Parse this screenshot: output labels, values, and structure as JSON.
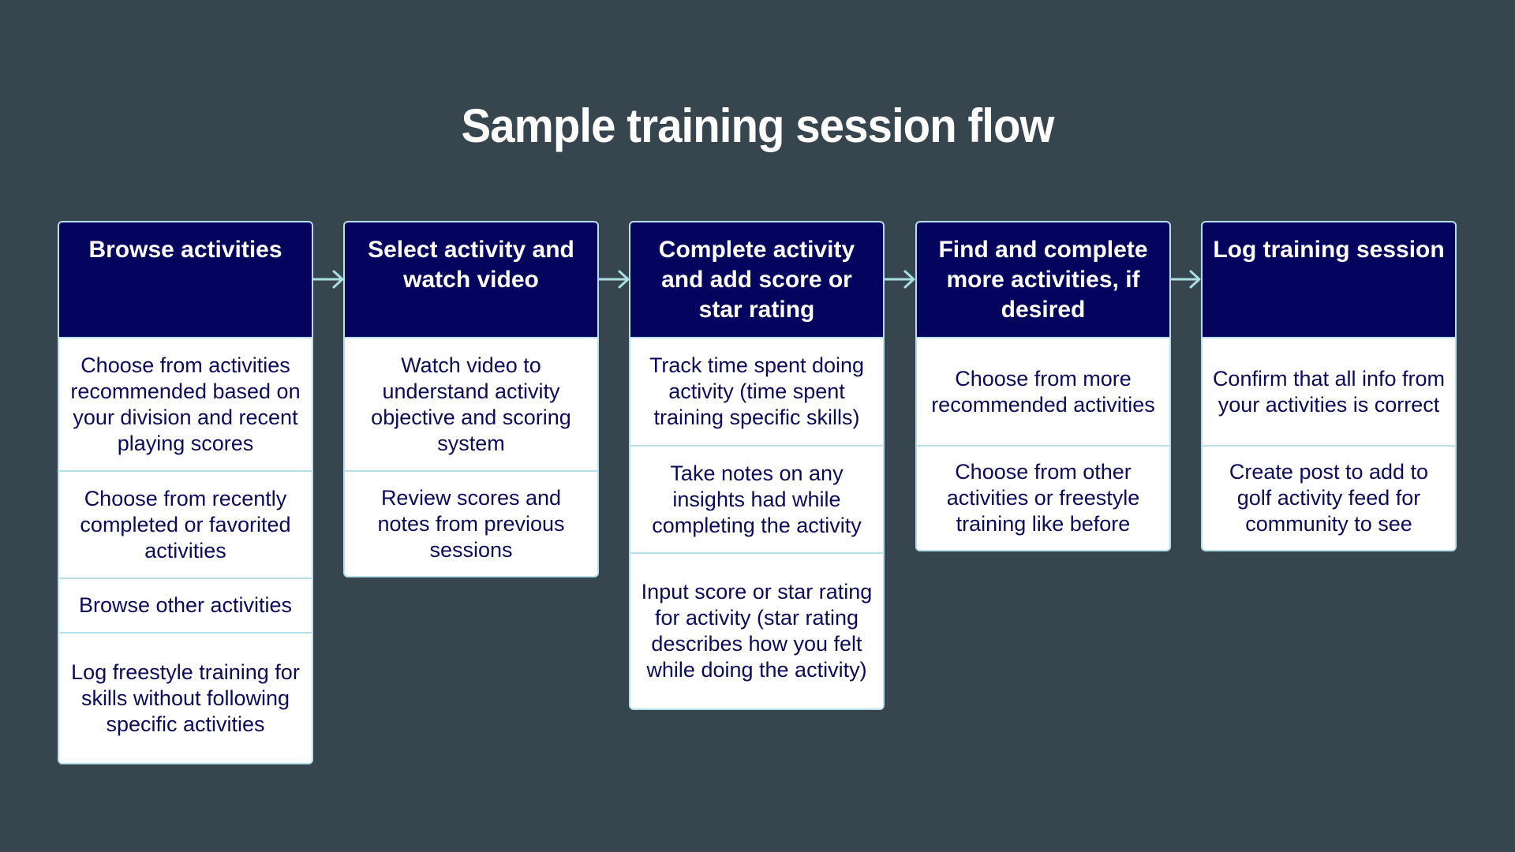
{
  "title": "Sample training session flow",
  "colors": {
    "background": "#37454f",
    "header": "#04045e",
    "header_text": "#ffffff",
    "body_text": "#0b0b5a",
    "border": "#b6e1ec",
    "arrow": "#a8dfe0"
  },
  "steps": [
    {
      "header": "Browse activities",
      "items": [
        "Choose from activities recommended based on your division and recent playing scores",
        "Choose from recently completed or favorited activities",
        "Browse other activities",
        "Log freestyle training for skills without following specific activities"
      ]
    },
    {
      "header": "Select activity and watch video",
      "items": [
        "Watch video to understand activity objective and scoring system",
        "Review scores and notes from previous sessions"
      ]
    },
    {
      "header": "Complete activity and add score or star rating",
      "items": [
        "Track time spent doing activity (time spent training specific skills)",
        "Take notes on any insights had while completing the activity",
        "Input score or star rating for activity (star rating describes how you felt while doing the activity)"
      ]
    },
    {
      "header": "Find and complete more activities, if desired",
      "items": [
        "Choose from more recommended activities",
        "Choose from other activities or freestyle training like before"
      ]
    },
    {
      "header": "Log training session",
      "items": [
        "Confirm that all info from your activities is correct",
        "Create post to add to golf activity feed for community to see"
      ]
    }
  ],
  "arrows": [
    {
      "from": 1,
      "to": 2,
      "icon": "arrow-right-icon"
    },
    {
      "from": 2,
      "to": 3,
      "icon": "arrow-right-icon"
    },
    {
      "from": 3,
      "to": 4,
      "icon": "arrow-right-icon"
    },
    {
      "from": 4,
      "to": 5,
      "icon": "arrow-right-icon"
    }
  ]
}
